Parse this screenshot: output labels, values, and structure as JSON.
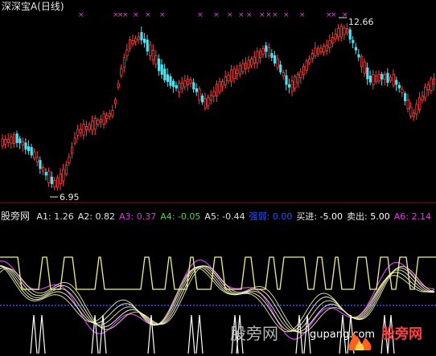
{
  "window": {
    "title": "深深宝A",
    "period": "(日线)"
  },
  "price_panel": {
    "high_label": "12.66",
    "low_label": "6.95",
    "marks": [
      "×",
      "×",
      "×",
      "×",
      "×",
      "×",
      "×",
      "×",
      "×",
      "×",
      "×",
      "×",
      "×",
      "×",
      "×",
      "×",
      "×",
      "×",
      "×",
      "×"
    ]
  },
  "indicator_panel": {
    "name": "股旁网",
    "items": [
      {
        "key": "A1:",
        "value": "1.26",
        "color": "#e0e0e0"
      },
      {
        "key": "A2:",
        "value": "0.82",
        "color": "#e0e0e0"
      },
      {
        "key": "A3:",
        "value": "0.37",
        "color": "#d040d0"
      },
      {
        "key": "A4:",
        "value": "-0.05",
        "color": "#50d050"
      },
      {
        "key": "A5:",
        "value": "-0.44",
        "color": "#e0e0e0"
      },
      {
        "key": "强弱:",
        "value": "0.00",
        "color": "#3050ff"
      },
      {
        "key": "买进:",
        "value": "-5.00",
        "color": "#ffffff"
      },
      {
        "key": "卖出:",
        "value": "5.00",
        "color": "#ffffff"
      },
      {
        "key": "A6:",
        "value": "2.14",
        "color": "#e040e0"
      }
    ]
  },
  "watermark": {
    "left": "股旁网",
    "right": "gupang.com",
    "logo": "股旁网"
  },
  "colors": {
    "up": "#ff4040",
    "down": "#50e0f0",
    "yellow": "#f0f090",
    "purple": "#c040e0",
    "blue": "#3050ff"
  }
}
